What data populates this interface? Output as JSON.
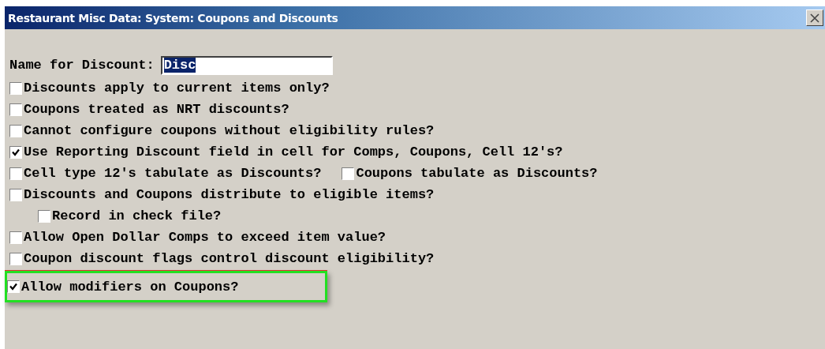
{
  "window": {
    "title": "Restaurant Misc Data:  System: Coupons and Discounts"
  },
  "name_field": {
    "label": "Name for Discount:",
    "value": "Disc",
    "selected": true
  },
  "options": [
    {
      "highlighted": false,
      "checks": [
        {
          "label": "Discounts apply to current items only?",
          "checked": false
        }
      ]
    },
    {
      "highlighted": false,
      "checks": [
        {
          "label": "Coupons treated as NRT discounts?",
          "checked": false
        }
      ]
    },
    {
      "highlighted": false,
      "checks": [
        {
          "label": "Cannot configure coupons without eligibility rules?",
          "checked": false
        }
      ]
    },
    {
      "highlighted": false,
      "checks": [
        {
          "label": "Use Reporting Discount field in cell for Comps, Coupons, Cell 12's?",
          "checked": true
        }
      ]
    },
    {
      "highlighted": false,
      "checks": [
        {
          "label": "Cell type 12's tabulate as Discounts?",
          "checked": false
        },
        {
          "label": "Coupons tabulate as Discounts?",
          "checked": false
        }
      ]
    },
    {
      "highlighted": false,
      "checks": [
        {
          "label": "Discounts and Coupons distribute to eligible items?",
          "checked": false
        }
      ],
      "children": [
        {
          "highlighted": false,
          "checks": [
            {
              "label": "Record in check file?",
              "checked": false
            }
          ]
        }
      ]
    },
    {
      "highlighted": false,
      "checks": [
        {
          "label": "Allow Open Dollar Comps to exceed item value?",
          "checked": false
        }
      ]
    },
    {
      "highlighted": false,
      "checks": [
        {
          "label": "Coupon discount flags control discount eligibility?",
          "checked": false
        }
      ]
    },
    {
      "highlighted": true,
      "checks": [
        {
          "label": "Allow modifiers on Coupons?",
          "checked": true
        }
      ]
    }
  ]
}
